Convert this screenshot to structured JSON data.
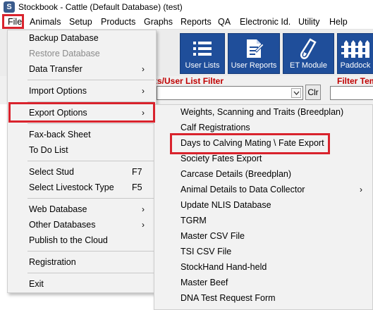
{
  "window": {
    "logo_letter": "S",
    "title": "Stockbook - Cattle (Default Database) (test)"
  },
  "menubar": [
    "File",
    "Animals",
    "Setup",
    "Products",
    "Graphs",
    "Reports",
    "QA",
    "Electronic Id.",
    "Utility",
    "Help"
  ],
  "toolbar": {
    "buttons": [
      {
        "label": "User Lists",
        "icon": "list-icon"
      },
      {
        "label": "User Reports",
        "icon": "report-icon"
      },
      {
        "label": "ET Module",
        "icon": "test-tube-icon"
      },
      {
        "label": "Paddock",
        "icon": "fence-icon"
      }
    ]
  },
  "filter": {
    "label1": "ts/User List Filter",
    "label2": "Filter Tem",
    "clear_label": "Clr",
    "value": ""
  },
  "file_menu": {
    "items": [
      {
        "label": "Backup Database",
        "submenu": false,
        "disabled": false,
        "shortcut": ""
      },
      {
        "label": "Restore Database",
        "submenu": false,
        "disabled": true,
        "shortcut": ""
      },
      {
        "label": "Data Transfer",
        "submenu": true,
        "disabled": false,
        "shortcut": ""
      },
      {
        "label": "Import Options",
        "submenu": true,
        "disabled": false,
        "shortcut": ""
      },
      {
        "label": "Export Options",
        "submenu": true,
        "disabled": false,
        "shortcut": ""
      },
      {
        "label": "Fax-back Sheet",
        "submenu": false,
        "disabled": false,
        "shortcut": ""
      },
      {
        "label": "To Do List",
        "submenu": false,
        "disabled": false,
        "shortcut": ""
      },
      {
        "label": "Select Stud",
        "submenu": false,
        "disabled": false,
        "shortcut": "F7"
      },
      {
        "label": "Select Livestock Type",
        "submenu": false,
        "disabled": false,
        "shortcut": "F5"
      },
      {
        "label": "Web Database",
        "submenu": true,
        "disabled": false,
        "shortcut": ""
      },
      {
        "label": "Other Databases",
        "submenu": true,
        "disabled": false,
        "shortcut": ""
      },
      {
        "label": "Publish to the Cloud",
        "submenu": false,
        "disabled": false,
        "shortcut": ""
      },
      {
        "label": "Registration",
        "submenu": false,
        "disabled": false,
        "shortcut": ""
      },
      {
        "label": "Exit",
        "submenu": false,
        "disabled": false,
        "shortcut": ""
      }
    ]
  },
  "export_submenu": {
    "items": [
      {
        "label": "Weights, Scanning and Traits (Breedplan)",
        "submenu": false
      },
      {
        "label": "Calf Registrations",
        "submenu": false
      },
      {
        "label": "Days to Calving Mating \\ Fate Export",
        "submenu": false
      },
      {
        "label": "Society Fates Export",
        "submenu": false
      },
      {
        "label": "Carcase Details (Breedplan)",
        "submenu": false
      },
      {
        "label": "Animal Details to Data Collector",
        "submenu": true
      },
      {
        "label": "Update NLIS Database",
        "submenu": false
      },
      {
        "label": "TGRM",
        "submenu": false
      },
      {
        "label": "Master CSV File",
        "submenu": false
      },
      {
        "label": "TSI CSV File",
        "submenu": false
      },
      {
        "label": "StockHand Hand-held",
        "submenu": false
      },
      {
        "label": "Master Beef",
        "submenu": false
      },
      {
        "label": "DNA Test Request Form",
        "submenu": false
      }
    ]
  },
  "colors": {
    "highlight": "#d9232d",
    "toolbar_button": "#1f4e9a",
    "filter_label": "#c00000"
  },
  "arrow_glyph": "›"
}
